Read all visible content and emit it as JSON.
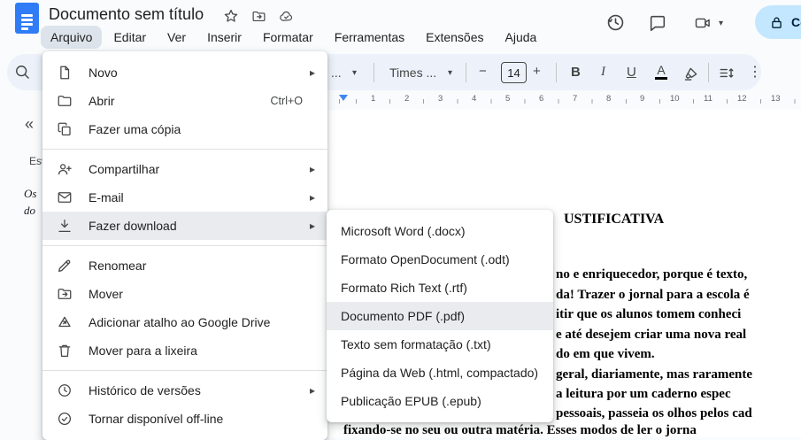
{
  "topbar": {
    "doc_title": "Documento sem título",
    "share_button": {
      "label": "Co"
    }
  },
  "menu_bar": {
    "items": [
      "Arquivo",
      "Editar",
      "Ver",
      "Inserir",
      "Formatar",
      "Ferramentas",
      "Extensões",
      "Ajuda"
    ],
    "active": "Arquivo"
  },
  "toolbar": {
    "hidden_dropdown_text": "...",
    "font_family": "Times ...",
    "font_size_value": "14",
    "bold_label": "B",
    "italic_label": "I",
    "underline_label": "U",
    "text_color_label": "A"
  },
  "icons": {
    "caret_down": "▾",
    "submenu_arrow": "▸",
    "kebab": "⋮",
    "minus": "−",
    "plus": "+",
    "collapse_chevron": "«"
  },
  "ruler": {
    "numbers": [
      "1",
      "2",
      "3",
      "4",
      "5",
      "6",
      "7",
      "8",
      "9",
      "10",
      "11",
      "12",
      "13"
    ]
  },
  "outline_panel": {
    "heading_fragment": "Est",
    "entry_fragments": [
      "Os",
      "do"
    ]
  },
  "file_menu": {
    "items": [
      {
        "label": "Novo"
      },
      {
        "label": "Abrir",
        "shortcut": "Ctrl+O"
      },
      {
        "label": "Fazer uma cópia"
      },
      {
        "label": "Compartilhar"
      },
      {
        "label": "E-mail"
      },
      {
        "label": "Fazer download"
      },
      {
        "label": "Renomear"
      },
      {
        "label": "Mover"
      },
      {
        "label": "Adicionar atalho ao Google Drive"
      },
      {
        "label": "Mover para a lixeira"
      },
      {
        "label": "Histórico de versões"
      },
      {
        "label": "Tornar disponível off-line"
      }
    ]
  },
  "download_submenu": {
    "items": [
      "Microsoft Word (.docx)",
      "Formato OpenDocument (.odt)",
      "Formato Rich Text (.rtf)",
      "Documento PDF (.pdf)",
      "Texto sem formatação (.txt)",
      "Página da Web (.html, compactado)",
      "Publicação EPUB (.epub)"
    ]
  },
  "document": {
    "title_fragment": "USTIFICATIVA",
    "body_lines": [
      "no e enriquecedor, porque é texto,",
      "da! Trazer o jornal para a escola é",
      "itir que os alunos tomem conheci",
      "e até desejem criar uma nova real",
      "do em que vivem.",
      "geral, diariamente, mas raramente",
      "a leitura por um caderno espec",
      "pessoais, passeia os olhos pelos cad",
      "fixando-se no seu ou outra matéria. Esses modos de ler o jorna"
    ]
  },
  "colors": {
    "accent_blue": "#2f7cf6",
    "share_pill": "#c2e7ff",
    "toolbar_bg": "#edf2fa",
    "menu_highlight": "#e9ebee"
  }
}
